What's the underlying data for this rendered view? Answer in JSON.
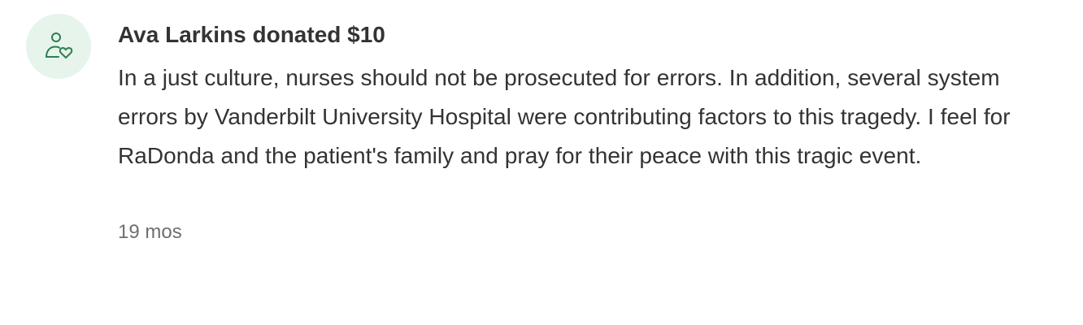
{
  "comment": {
    "avatar_icon": "person-heart-icon",
    "avatar_bg": "#e6f4ec",
    "icon_color": "#2e7d4f",
    "author_donation": "Ava Larkins donated $10",
    "message": "In a just culture, nurses should not be prosecuted for errors. In addition, several system errors by Vanderbilt University Hospital were contributing factors to this tragedy. I feel for RaDonda and the patient's family and pray for their peace with this tragic event.",
    "time_ago": "19 mos"
  }
}
